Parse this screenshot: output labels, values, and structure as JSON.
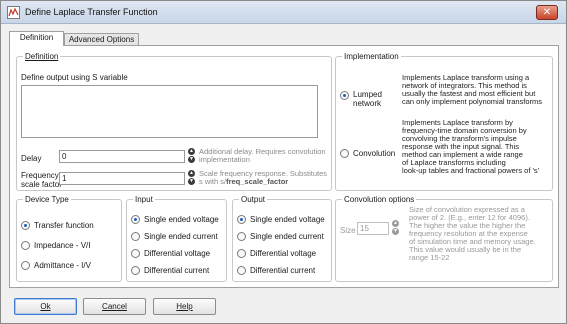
{
  "window": {
    "title": "Define Laplace Transfer Function"
  },
  "tabs": [
    {
      "label": "Definition",
      "active": true
    },
    {
      "label": "Advanced Options",
      "active": false
    }
  ],
  "definition": {
    "group_title": "Definition",
    "prompt": "Define output using S variable",
    "expression": "",
    "delay": {
      "label": "Delay",
      "value": "0",
      "hint": "Additional delay. Requires convolution implementation"
    },
    "frequency_scale": {
      "label_line1": "Frequency",
      "label_line2": "scale factor",
      "value": "1",
      "hint_line1": "Scale frequency response. Substitutes",
      "hint_line2_prefix": "s with s/",
      "hint_line2_bold": "freq_scale_factor"
    }
  },
  "implementation": {
    "group_title": "Implementation",
    "options": [
      {
        "label_line1": "Lumped",
        "label_line2": "network",
        "selected": true,
        "description": [
          "Implements Laplace transform using a",
          "network of integrators. This method is",
          "usually the fastest and most efficient but",
          "can only implement polynomial transforms"
        ]
      },
      {
        "label_line1": "Convolution",
        "label_line2": "",
        "selected": false,
        "description": [
          "Implements Laplace transform by",
          "frequency-time domain conversion by",
          "convolving the transform's impulse",
          "response with the input signal. This",
          "method can implement a wide range",
          "of Laplace transforms including",
          "look-up tables and fractional powers of 's'"
        ]
      }
    ]
  },
  "device_type": {
    "group_title": "Device Type",
    "options": [
      {
        "label": "Transfer function",
        "selected": true
      },
      {
        "label": "Impedance - V/I",
        "selected": false
      },
      {
        "label": "Admittance - I/V",
        "selected": false
      }
    ]
  },
  "input": {
    "group_title": "Input",
    "options": [
      {
        "label": "Single ended voltage",
        "selected": true
      },
      {
        "label": "Single ended current",
        "selected": false
      },
      {
        "label": "Differential voltage",
        "selected": false
      },
      {
        "label": "Differential current",
        "selected": false
      }
    ]
  },
  "output": {
    "group_title": "Output",
    "options": [
      {
        "label": "Single ended voltage",
        "selected": true
      },
      {
        "label": "Single ended current",
        "selected": false
      },
      {
        "label": "Differential voltage",
        "selected": false
      },
      {
        "label": "Differential current",
        "selected": false
      }
    ]
  },
  "convolution_options": {
    "group_title": "Convolution options",
    "size_label": "Size",
    "size_value": "15",
    "description": [
      "Size of convolution expressed as a",
      "power of 2. (E.g., enter 12 for 4096).",
      "The higher the value the higher the",
      "frequency resolution at the expense",
      "of simulation time and memory usage.",
      "This value would usually be in the",
      "range 15-22"
    ]
  },
  "buttons": {
    "ok": "Ok",
    "cancel": "Cancel",
    "help": "Help"
  }
}
